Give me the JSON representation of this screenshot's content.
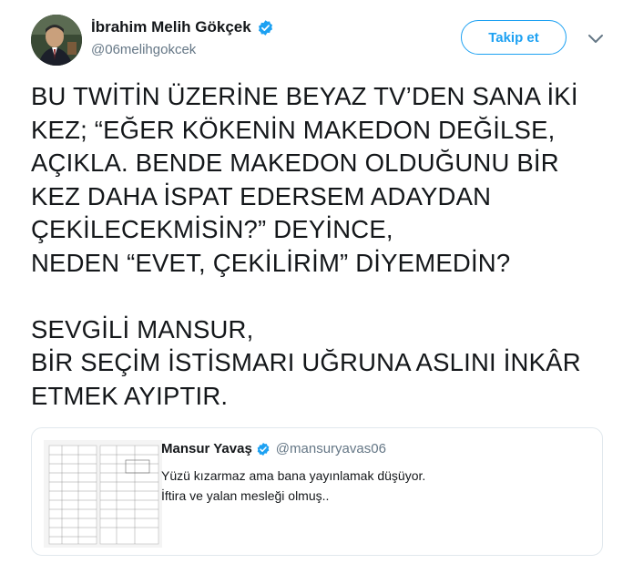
{
  "author": {
    "display_name": "İbrahim Melih Gökçek",
    "handle": "@06melihgokcek",
    "verified_icon": "verified-badge-icon",
    "avatar": "avatar-photo"
  },
  "actions": {
    "follow_label": "Takip et",
    "more_icon": "chevron-down-icon"
  },
  "tweet": {
    "lines": [
      "BU TWİTİN ÜZERİNE BEYAZ TV’DEN SANA İKİ",
      "KEZ; “EĞER KÖKENİN MAKEDON DEĞİLSE,",
      "AÇIKLA. BENDE MAKEDON OLDUĞUNU BİR",
      "KEZ DAHA İSPAT EDERSEM ADAYDAN",
      "ÇEKİLECEKMİSİN?” DEYİNCE,",
      "NEDEN “EVET, ÇEKİLİRİM” DİYEMEDİN?",
      "",
      "SEVGİLİ MANSUR,",
      "BİR SEÇİM İSTİSMARI UĞRUNA ASLINI İNKÂR",
      "ETMEK AYIPTIR."
    ]
  },
  "quoted": {
    "display_name": "Mansur Yavaş",
    "handle": "@mansuryavas06",
    "text_lines": [
      "Yüzü kızarmaz ama bana yayınlamak düşüyor.",
      "İftira ve yalan mesleği olmuş.."
    ],
    "thumbnail": "document-scan-thumbnail"
  },
  "colors": {
    "accent": "#1da1f2",
    "text": "#14171a",
    "muted": "#657786",
    "border": "#e1e8ed"
  }
}
